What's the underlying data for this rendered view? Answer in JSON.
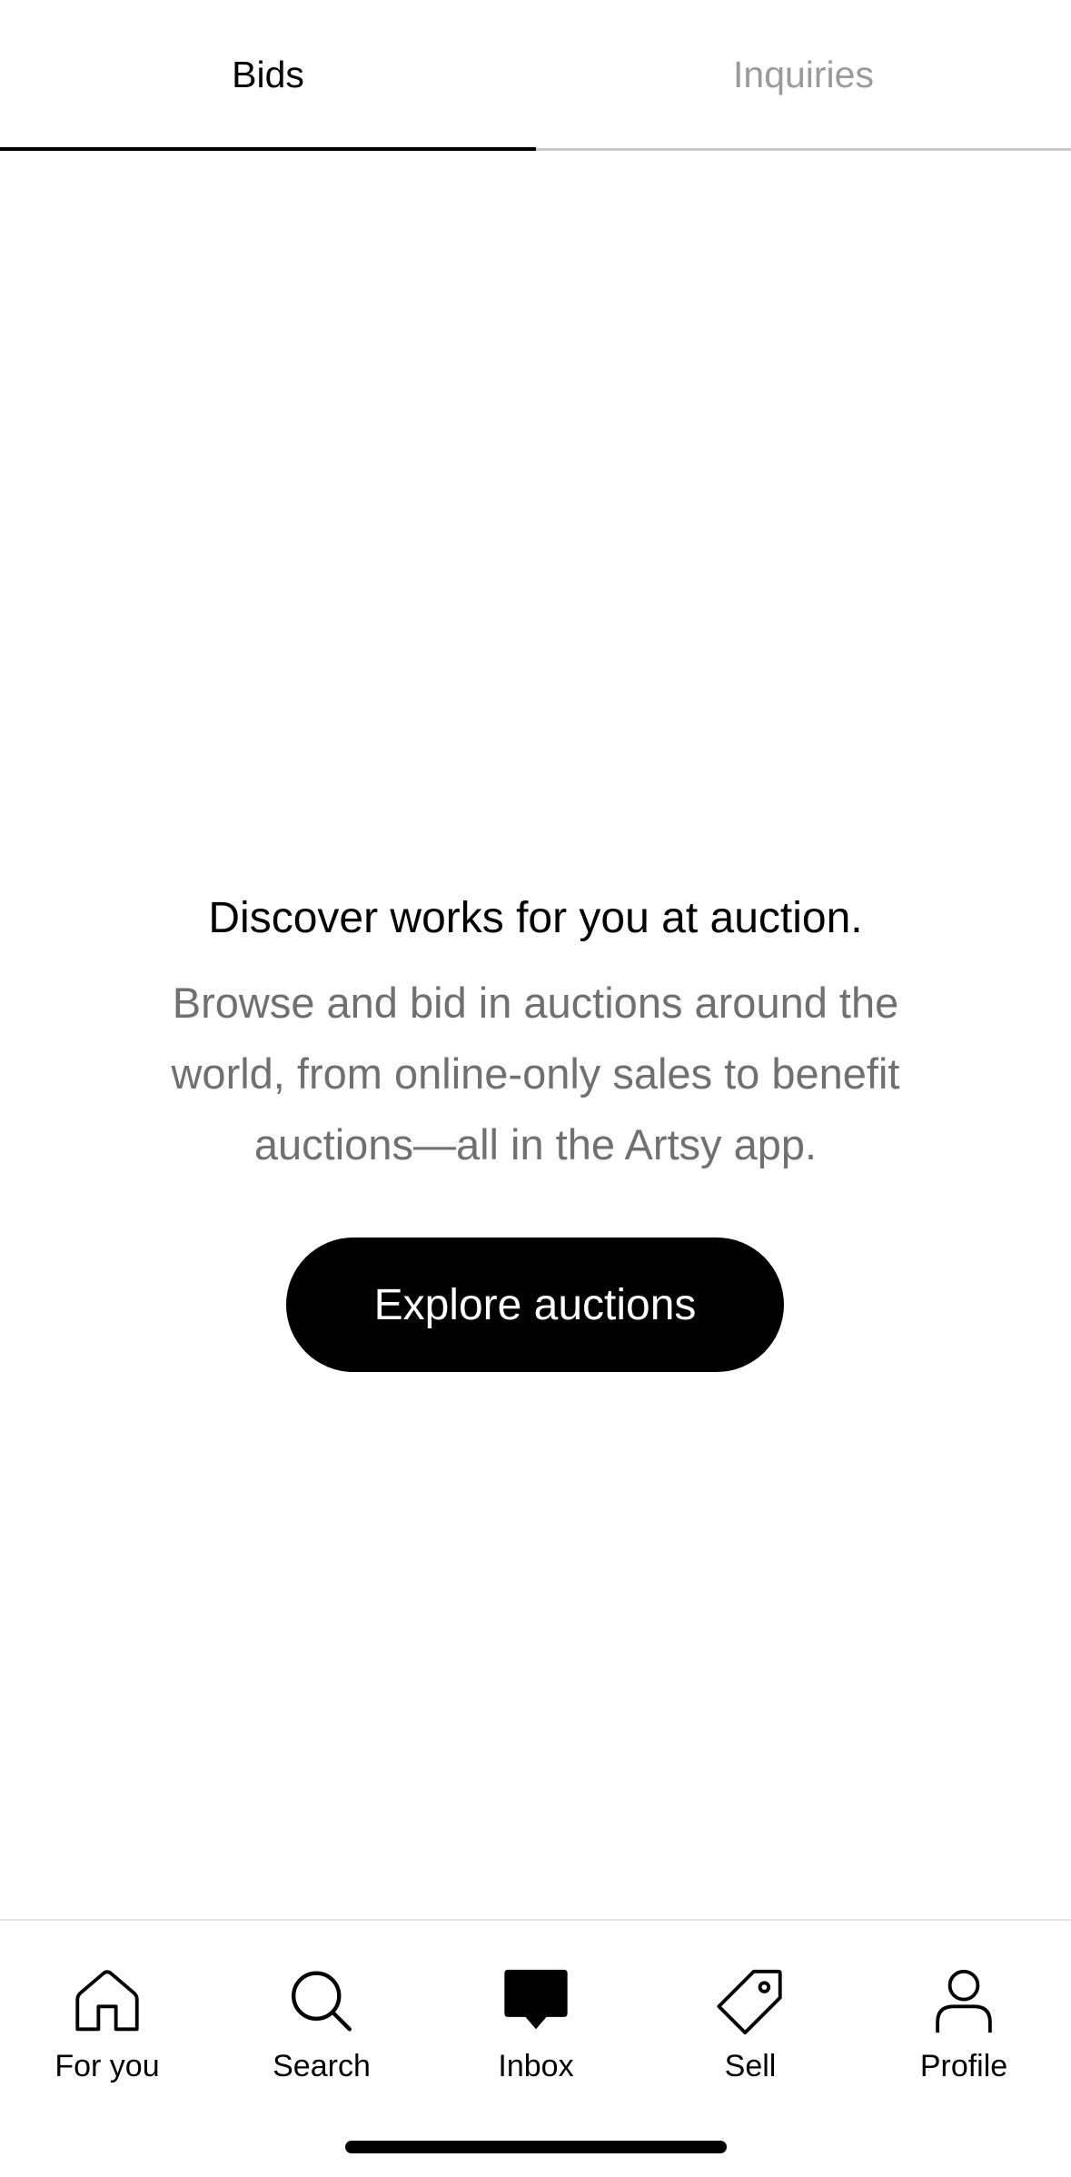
{
  "tabs": [
    {
      "label": "Bids",
      "active": true
    },
    {
      "label": "Inquiries",
      "active": false
    }
  ],
  "empty_state": {
    "title": "Discover works for you at auction.",
    "body": "Browse and bid in auctions around the world, from online-only sales to benefit auctions—all in the Artsy app.",
    "cta_label": "Explore auctions"
  },
  "bottom_nav": [
    {
      "label": "For you",
      "icon": "home-icon"
    },
    {
      "label": "Search",
      "icon": "search-icon"
    },
    {
      "label": "Inbox",
      "icon": "inbox-icon",
      "active": true
    },
    {
      "label": "Sell",
      "icon": "tag-icon"
    },
    {
      "label": "Profile",
      "icon": "profile-icon"
    }
  ],
  "colors": {
    "primary": "#000000",
    "inactive_tab": "#9a9a9a",
    "body_text": "#707070",
    "background": "#ffffff"
  }
}
